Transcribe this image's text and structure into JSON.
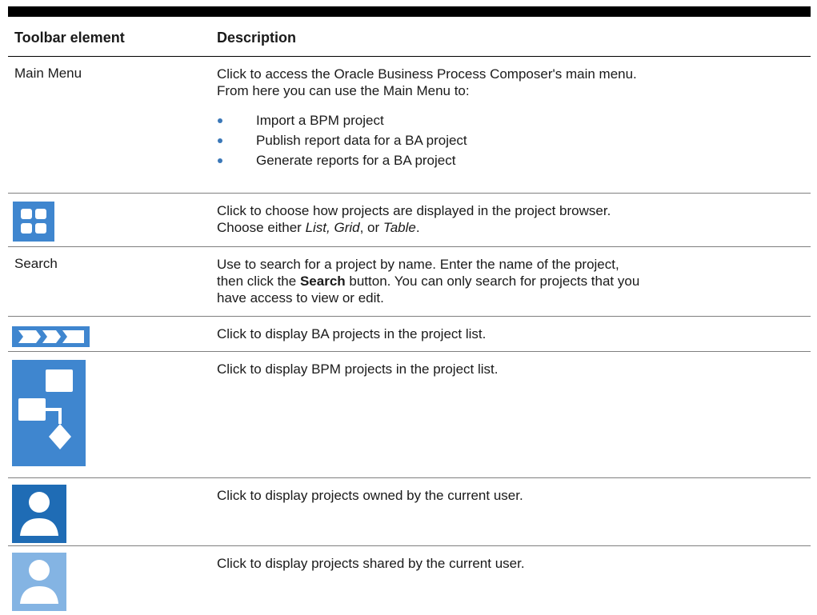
{
  "table": {
    "header": {
      "col1": "Toolbar element",
      "col2": "Description"
    },
    "rows": {
      "main_menu": {
        "label": "Main Menu",
        "line1": "Click to access the Oracle Business Process Composer's main menu.",
        "line2": "From here you can use the Main Menu to:",
        "bullets": [
          "Import a BPM project",
          "Publish report data for a BA project",
          "Generate reports for a BA project"
        ]
      },
      "view_mode": {
        "icon": "grid-view-icon",
        "line1": "Click to choose how projects are displayed in the project browser.",
        "line2_prefix": "Choose either ",
        "opt1": "List, Grid",
        "sep": ", or ",
        "opt2": "Table",
        "end": "."
      },
      "search": {
        "label": "Search",
        "line1": "Use to search for a project by name. Enter the name of the project,",
        "line2_prefix": "then click the ",
        "search_word": "Search",
        "line2_suffix": " button. You can only search for projects that you",
        "line3": "have access to view or edit."
      },
      "ba_projects": {
        "icon": "ba-projects-icon",
        "text": "Click to display BA projects in the project list."
      },
      "bpm_projects": {
        "icon": "bpm-projects-icon",
        "text": "Click to display BPM projects in the project list."
      },
      "owned": {
        "icon": "owned-user-icon",
        "text": "Click to display projects owned by the current user."
      },
      "shared": {
        "icon": "shared-user-icon",
        "text": "Click to display projects shared by the current user."
      }
    }
  },
  "colors": {
    "icon_blue": "#3f86cf",
    "owned_blue": "#1f6cb5",
    "shared_blue": "#84b4e3",
    "bullet": "#3b78b8"
  }
}
